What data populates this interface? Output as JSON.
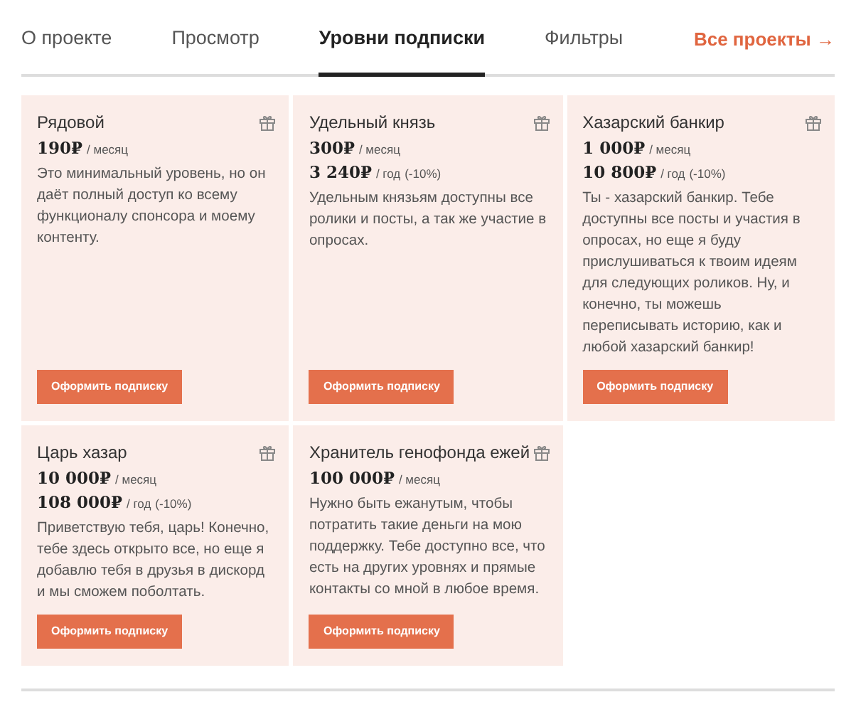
{
  "tabs": [
    {
      "label": "О проекте",
      "selected": false
    },
    {
      "label": "Просмотр",
      "selected": false
    },
    {
      "label": "Уровни подписки",
      "selected": true
    },
    {
      "label": "Фильтры",
      "selected": false
    }
  ],
  "all_projects_link": {
    "label": "Все проекты",
    "arrow": "→"
  },
  "tiers": [
    {
      "name": "Рядовой",
      "prices": [
        {
          "amount": "190₽",
          "period": "/ месяц"
        }
      ],
      "description": "Это минимальный уровень, но он даёт полный доступ ко всему функционалу спонсора и моему контенту.",
      "button": "Оформить подписку"
    },
    {
      "name": "Удельный князь",
      "prices": [
        {
          "amount": "300₽",
          "period": "/ месяц"
        },
        {
          "amount": "3 240₽",
          "period": "/ год",
          "note": "(-10%)"
        }
      ],
      "description": "Удельным князьям доступны все ролики и посты, а так же участие в опросах.",
      "button": "Оформить подписку"
    },
    {
      "name": "Хазарский банкир",
      "prices": [
        {
          "amount": "1 000₽",
          "period": "/ месяц"
        },
        {
          "amount": "10 800₽",
          "period": "/ год",
          "note": "(-10%)"
        }
      ],
      "description": "Ты - хазарский банкир. Тебе доступны все посты и участия в опросах, но еще я буду прислушиваться к твоим идеям для следующих роликов. Ну, и конечно, ты можешь переписывать историю, как и любой хазарский банкир!",
      "button": "Оформить подписку"
    },
    {
      "name": "Царь хазар",
      "prices": [
        {
          "amount": "10 000₽",
          "period": "/ месяц"
        },
        {
          "amount": "108 000₽",
          "period": "/ год",
          "note": "(-10%)"
        }
      ],
      "description": "Приветствую тебя, царь! Конечно, тебе здесь открыто все, но еще я добавлю тебя в друзья в дискорд и мы сможем поболтать.",
      "button": "Оформить подписку"
    },
    {
      "name": "Хранитель генофонда ежей",
      "prices": [
        {
          "amount": "100 000₽",
          "period": "/ месяц"
        }
      ],
      "description": "Нужно быть ежанутым, чтобы потратить такие деньги на мою поддержку. Тебе доступно все, что есть на других уровнях и прямые контакты со мной в любое время.",
      "button": "Оформить подписку"
    }
  ]
}
